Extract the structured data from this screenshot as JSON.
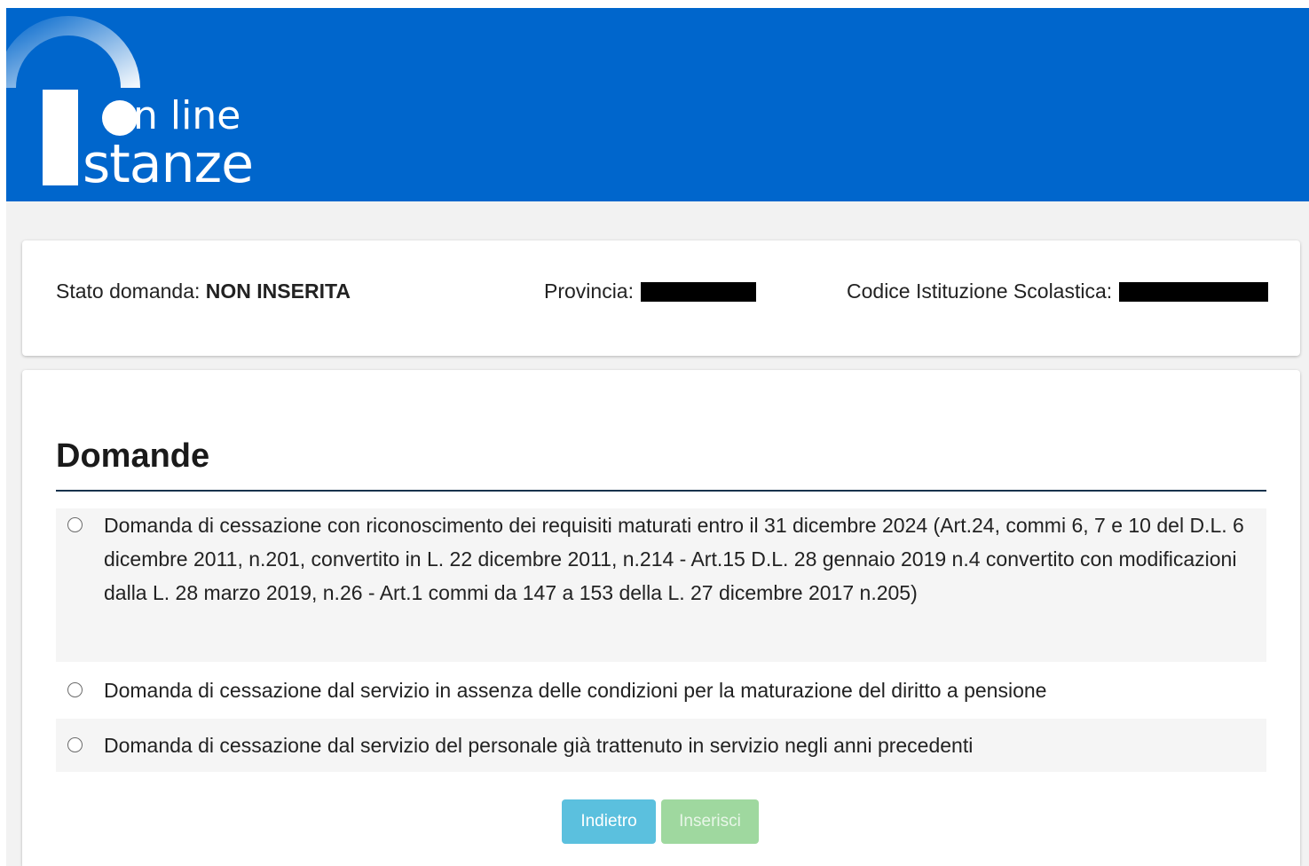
{
  "header": {
    "logo_line1": "n line",
    "logo_line2": "stanze",
    "colors": {
      "background": "#0066cc"
    }
  },
  "status": {
    "state_label": "Stato domanda:",
    "state_value": "NON INSERITA",
    "province_label": "Provincia:",
    "province_value_redacted": true,
    "school_code_label": "Codice Istituzione Scolastica:",
    "school_code_value_redacted": true
  },
  "domande": {
    "title": "Domande",
    "options": [
      {
        "label": "Domanda di cessazione con riconoscimento dei requisiti maturati entro il 31 dicembre 2024 (Art.24, commi 6, 7 e 10 del D.L. 6 dicembre 2011, n.201, convertito in L. 22 dicembre 2011, n.214 - Art.15 D.L. 28 gennaio 2019 n.4 convertito con modificazioni dalla L. 28 marzo 2019, n.26 - Art.1 commi da 147 a 153 della L. 27 dicembre 2017 n.205)",
        "selected": false
      },
      {
        "label": "Domanda di cessazione dal servizio in assenza delle condizioni per la maturazione del diritto a pensione",
        "selected": false
      },
      {
        "label": "Domanda di cessazione dal servizio del personale già trattenuto in servizio negli anni precedenti",
        "selected": false
      }
    ]
  },
  "buttons": {
    "back_label": "Indietro",
    "insert_label": "Inserisci",
    "colors": {
      "back": "#5bc0de",
      "insert": "#9fd89f"
    }
  }
}
